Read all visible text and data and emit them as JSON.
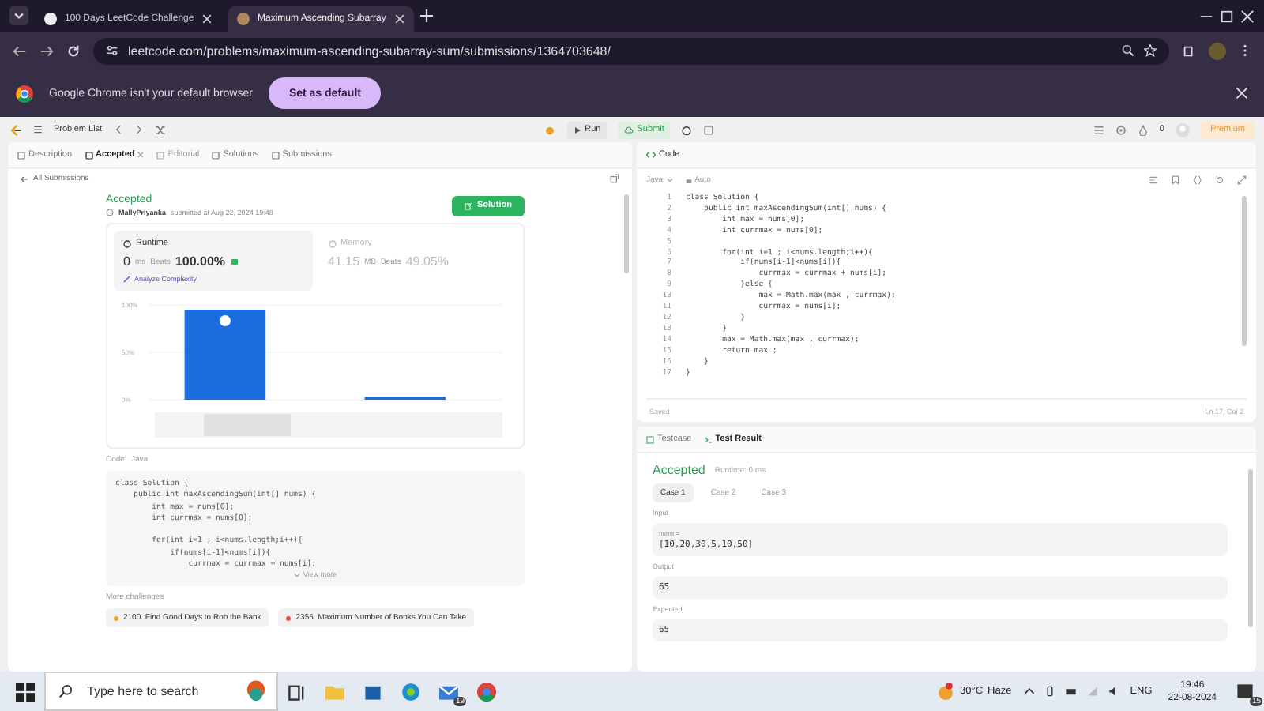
{
  "browser": {
    "tabs": [
      {
        "title": "100 Days LeetCode Challenge",
        "selected": false
      },
      {
        "title": "Maximum Ascending Subarray",
        "selected": true
      }
    ],
    "url": "leetcode.com/problems/maximum-ascending-subarray-sum/submissions/1364703648/",
    "infobar": {
      "message": "Google Chrome isn't your default browser",
      "button": "Set as default"
    }
  },
  "topbar": {
    "problem_list": "Problem List",
    "run": "Run",
    "submit": "Submit",
    "streak": "0",
    "premium": "Premium"
  },
  "left_panel": {
    "tabs": [
      {
        "label": "Description",
        "selected": false,
        "disabled": false
      },
      {
        "label": "Accepted",
        "selected": true,
        "disabled": false
      },
      {
        "label": "Editorial",
        "selected": false,
        "disabled": true
      },
      {
        "label": "Solutions",
        "selected": false,
        "disabled": false
      },
      {
        "label": "Submissions",
        "selected": false,
        "disabled": false
      }
    ],
    "back_link": "All Submissions",
    "submission": {
      "status": "Accepted",
      "author": "MallyPriyanka",
      "submitted": "submitted at Aug 22, 2024 19:48",
      "solution_button": "Solution",
      "stats": [
        {
          "label": "Runtime",
          "value": "0",
          "unit": "ms",
          "beats_label": "Beats",
          "beats": "100.00%",
          "selected": true,
          "link": "Analyze Complexity"
        },
        {
          "label": "Memory",
          "value": "41.15",
          "unit": "MB",
          "beats_label": "Beats",
          "beats": "49.05%",
          "selected": false
        }
      ],
      "chart_data": {
        "type": "bar",
        "values": [
          95,
          3
        ],
        "ylim": [
          0,
          100
        ],
        "yticks": [
          {
            "value": 0,
            "label": "0%"
          },
          {
            "value": 50,
            "label": "50%"
          },
          {
            "value": 100,
            "label": "100%"
          }
        ]
      },
      "code_label": "Code",
      "language": "Java",
      "code": "class Solution {\n    public int maxAscendingSum(int[] nums) {\n        int max = nums[0];\n        int currmax = nums[0];\n\n        for(int i=1 ; i<nums.length;i++){\n            if(nums[i-1]<nums[i]){\n                currmax = currmax + nums[i];",
      "view_more": "View more",
      "more_label": "More challenges",
      "challenges": [
        {
          "title": "2100. Find Good Days to Rob the Bank",
          "color": "#f5a623"
        },
        {
          "title": "2355. Maximum Number of Books You Can Take",
          "color": "#e0554a"
        }
      ]
    }
  },
  "editor": {
    "title": "Code",
    "language": "Java",
    "mode": "Auto",
    "lines": [
      {
        "number": "1",
        "text": "class Solution {"
      },
      {
        "number": "2",
        "text": "    public int maxAscendingSum(int[] nums) {"
      },
      {
        "number": "3",
        "text": "        int max = nums[0];"
      },
      {
        "number": "4",
        "text": "        int currmax = nums[0];"
      },
      {
        "number": "5"
      },
      {
        "number": "6",
        "text": "        for(int i=1 ; i<nums.length;i++){"
      },
      {
        "number": "7",
        "text": "            if(nums[i-1]<nums[i]){"
      },
      {
        "number": "8",
        "text": "                currmax = currmax + nums[i];"
      },
      {
        "number": "9",
        "text": "            }else {"
      },
      {
        "number": "10",
        "text": "                max = Math.max(max , currmax);"
      },
      {
        "number": "11",
        "text": "                currmax = nums[i];"
      },
      {
        "number": "12",
        "text": "            }"
      },
      {
        "number": "13",
        "text": "        }"
      },
      {
        "number": "14",
        "text": "        max = Math.max(max , currmax);"
      },
      {
        "number": "15",
        "text": "        return max ;"
      },
      {
        "number": "16",
        "text": "    }"
      },
      {
        "number": "17",
        "text": "}"
      }
    ],
    "status": "Saved",
    "cursor": "Ln 17, Col 2"
  },
  "test_panel": {
    "tabs": [
      {
        "label": "Testcase",
        "selected": false
      },
      {
        "label": "Test Result",
        "selected": true
      }
    ],
    "status": "Accepted",
    "runtime": "Runtime: 0 ms",
    "cases": [
      {
        "label": "Case 1",
        "selected": true
      },
      {
        "label": "Case 2",
        "selected": false
      },
      {
        "label": "Case 3",
        "selected": false
      }
    ],
    "input_label": "Input",
    "param": "nums =",
    "input": "[10,20,30,5,10,50]",
    "output_label": "Output",
    "output": "65",
    "expected_label": "Expected",
    "expected": "65"
  },
  "taskbar": {
    "search_placeholder": "Type here to search",
    "mail_badge": "19",
    "temperature": "30°C",
    "condition": "Haze",
    "language": "ENG",
    "time": "19:46",
    "date": "22-08-2024",
    "notifications": "15"
  }
}
